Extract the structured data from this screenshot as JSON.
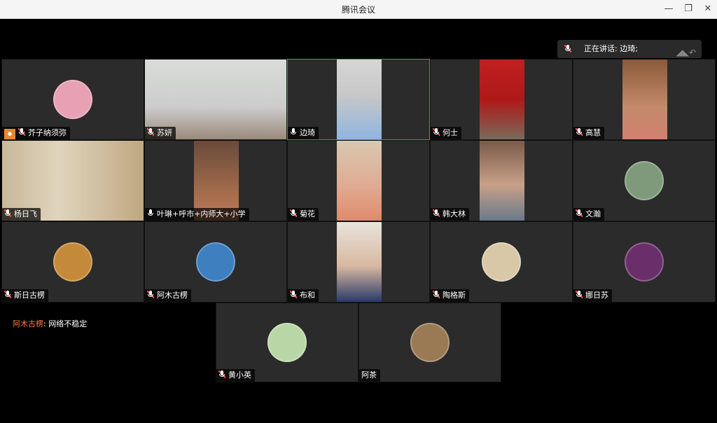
{
  "window": {
    "title": "腾讯会议",
    "controls": [
      "—",
      "❐",
      "✕"
    ]
  },
  "speaking_bar": {
    "label": "正在讲话: 边琦;"
  },
  "notice": {
    "name": "阿木古楞",
    "text": ": 网络不稳定"
  },
  "participants": [
    {
      "id": "p1",
      "name": "芥子纳须弥",
      "mic": "muted",
      "host": true,
      "view": "avatar",
      "color": "#e7a0b4"
    },
    {
      "id": "p2",
      "name": "苏妍",
      "mic": "muted",
      "view": "video"
    },
    {
      "id": "p3",
      "name": "边琦",
      "mic": "on",
      "view": "video",
      "active": true
    },
    {
      "id": "p4",
      "name": "何士",
      "mic": "muted",
      "view": "video"
    },
    {
      "id": "p5",
      "name": "高慧",
      "mic": "muted",
      "view": "video"
    },
    {
      "id": "p6",
      "name": "杨日飞",
      "mic": "muted",
      "view": "video"
    },
    {
      "id": "p7",
      "name": "叶琳+呼市+内师大+小学",
      "mic": "on",
      "view": "video"
    },
    {
      "id": "p8",
      "name": "菊花",
      "mic": "muted",
      "view": "video"
    },
    {
      "id": "p9",
      "name": "韩大林",
      "mic": "muted",
      "view": "video"
    },
    {
      "id": "p10",
      "name": "文瀚",
      "mic": "muted",
      "view": "avatar",
      "color": "#7e9a7a"
    },
    {
      "id": "p11",
      "name": "斯日古楞",
      "mic": "muted",
      "view": "avatar",
      "color": "#c48a3a"
    },
    {
      "id": "p12",
      "name": "阿木古楞",
      "mic": "muted",
      "view": "avatar",
      "color": "#3d7fbf"
    },
    {
      "id": "p13",
      "name": "布和",
      "mic": "muted",
      "view": "video"
    },
    {
      "id": "p14",
      "name": "陶格斯",
      "mic": "muted",
      "view": "avatar",
      "color": "#d8c8a8"
    },
    {
      "id": "p15",
      "name": "娜日苏",
      "mic": "muted",
      "view": "avatar",
      "color": "#6a2f6a"
    },
    {
      "id": "p16",
      "name": "黄小英",
      "mic": "muted",
      "view": "avatar",
      "color": "#b9d7a6"
    },
    {
      "id": "p17",
      "name": "阿茶",
      "mic": "none",
      "view": "avatar",
      "color": "#9a7a54"
    }
  ]
}
